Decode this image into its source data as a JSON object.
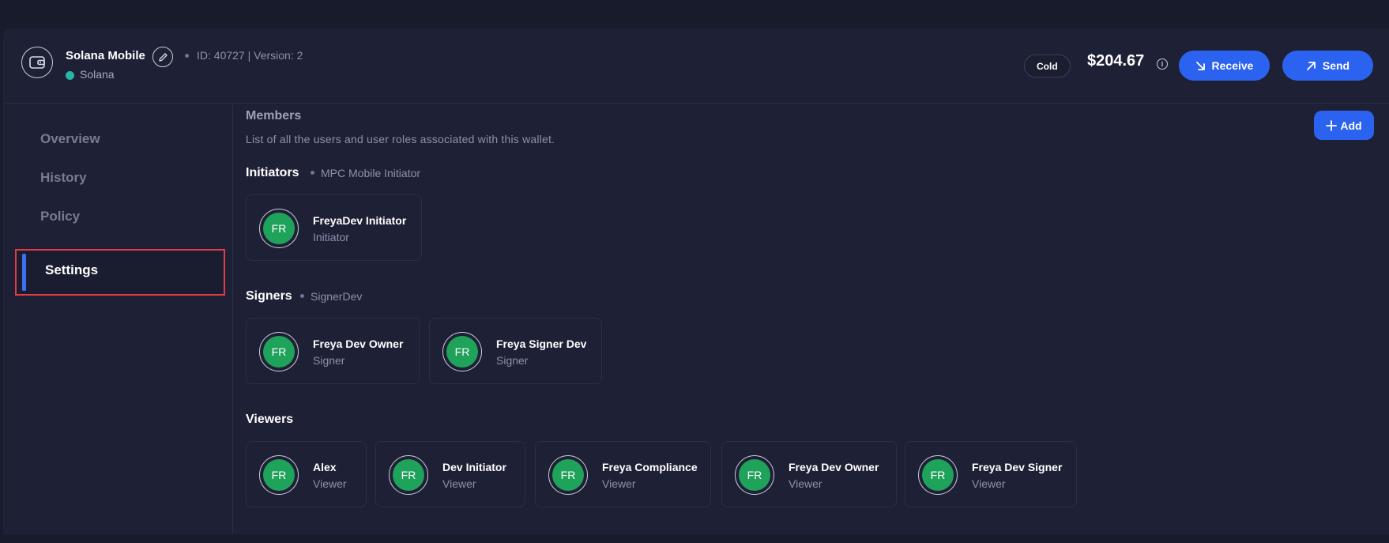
{
  "header": {
    "wallet_name": "Solana Mobile",
    "meta": "ID: 40727 | Version: 2",
    "chain": "Solana",
    "badge": "Cold",
    "balance": "$204.67",
    "receive_label": "Receive",
    "send_label": "Send",
    "colors": {
      "accent": "#2c62f0",
      "chain_dot": "#27b5a5"
    }
  },
  "sidebar": {
    "items": [
      {
        "label": "Overview",
        "active": false
      },
      {
        "label": "History",
        "active": false
      },
      {
        "label": "Policy",
        "active": false
      },
      {
        "label": "Settings",
        "active": true
      }
    ]
  },
  "main": {
    "title": "Members",
    "description": "List of all the users and user roles associated with this wallet.",
    "add_label": "Add",
    "sections": [
      {
        "title": "Initiators",
        "subtitle": "MPC Mobile Initiator",
        "members": [
          {
            "initials": "FR",
            "name": "FreyaDev Initiator",
            "role": "Initiator"
          }
        ]
      },
      {
        "title": "Signers",
        "subtitle": "SignerDev",
        "members": [
          {
            "initials": "FR",
            "name": "Freya Dev Owner",
            "role": "Signer"
          },
          {
            "initials": "FR",
            "name": "Freya Signer Dev",
            "role": "Signer"
          }
        ]
      },
      {
        "title": "Viewers",
        "subtitle": "",
        "members": [
          {
            "initials": "FR",
            "name": "Alex",
            "role": "Viewer"
          },
          {
            "initials": "FR",
            "name": "Dev Initiator",
            "role": "Viewer"
          },
          {
            "initials": "FR",
            "name": "Freya Compliance",
            "role": "Viewer"
          },
          {
            "initials": "FR",
            "name": "Freya Dev Owner",
            "role": "Viewer"
          },
          {
            "initials": "FR",
            "name": "Freya Dev Signer",
            "role": "Viewer"
          }
        ]
      }
    ],
    "avatar_color": "#1fa25a"
  }
}
